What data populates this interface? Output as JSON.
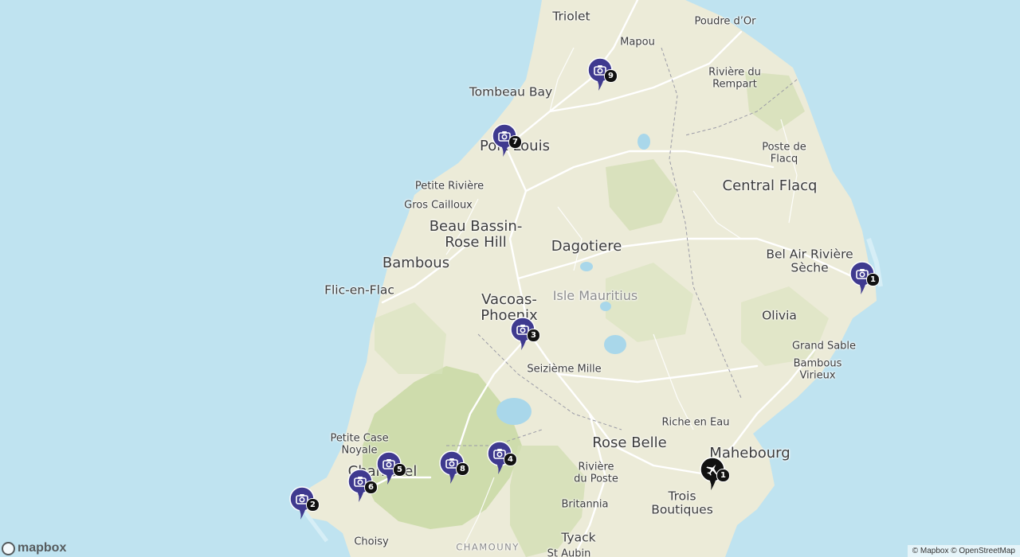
{
  "map": {
    "places": [
      {
        "name": "Triolet",
        "size": "md"
      },
      {
        "name": "Poudre d’Or",
        "size": "sm"
      },
      {
        "name": "Mapou",
        "size": "sm"
      },
      {
        "name": "Rivière du\nRempart",
        "size": "sm"
      },
      {
        "name": "Tombeau Bay",
        "size": "md"
      },
      {
        "name": "Port Louis",
        "size": "lg"
      },
      {
        "name": "Poste de\nFlacq",
        "size": "sm"
      },
      {
        "name": "Central Flacq",
        "size": "lg"
      },
      {
        "name": "Petite Rivière",
        "size": "sm"
      },
      {
        "name": "Gros Cailloux",
        "size": "sm"
      },
      {
        "name": "Beau Bassin-\nRose Hill",
        "size": "lg"
      },
      {
        "name": "Dagotiere",
        "size": "lg"
      },
      {
        "name": "Bambous",
        "size": "lg"
      },
      {
        "name": "Bel Air Rivière\nSèche",
        "size": "md"
      },
      {
        "name": "Flic-en-Flac",
        "size": "md"
      },
      {
        "name": "Vacoas-\nPhoenix",
        "size": "lg"
      },
      {
        "name": "Isle Mauritius",
        "size": "region"
      },
      {
        "name": "Olivia",
        "size": "md"
      },
      {
        "name": "Grand Sable",
        "size": "sm"
      },
      {
        "name": "Seizième Mille",
        "size": "sm"
      },
      {
        "name": "Bambous\nVirieux",
        "size": "sm"
      },
      {
        "name": "Riche en Eau",
        "size": "sm"
      },
      {
        "name": "Petite Case\nNoyale",
        "size": "sm"
      },
      {
        "name": "Rose Belle",
        "size": "lg"
      },
      {
        "name": "Mahebourg",
        "size": "lg"
      },
      {
        "name": "Chamarel",
        "size": "lg"
      },
      {
        "name": "Rivière\ndu Poste",
        "size": "sm"
      },
      {
        "name": "Trois\nBoutiques",
        "size": "md"
      },
      {
        "name": "Britannia",
        "size": "sm"
      },
      {
        "name": "Tyack",
        "size": "md"
      },
      {
        "name": "Choisy",
        "size": "sm"
      },
      {
        "name": "CHAMOUNY",
        "size": "caps"
      },
      {
        "name": "St Aubin",
        "size": "sm"
      }
    ],
    "markers": [
      {
        "id": "1",
        "icon": "camera-icon",
        "color": "#3f3a8f"
      },
      {
        "id": "2",
        "icon": "camera-icon",
        "color": "#3f3a8f"
      },
      {
        "id": "3",
        "icon": "camera-icon",
        "color": "#3f3a8f"
      },
      {
        "id": "4",
        "icon": "camera-icon",
        "color": "#3f3a8f"
      },
      {
        "id": "5",
        "icon": "camera-icon",
        "color": "#3f3a8f"
      },
      {
        "id": "6",
        "icon": "camera-icon",
        "color": "#3f3a8f"
      },
      {
        "id": "7",
        "icon": "camera-icon",
        "color": "#3f3a8f"
      },
      {
        "id": "8",
        "icon": "camera-icon",
        "color": "#3f3a8f"
      },
      {
        "id": "9",
        "icon": "camera-icon",
        "color": "#3f3a8f"
      },
      {
        "id": "1",
        "icon": "airplane-icon",
        "color": "#111111"
      }
    ],
    "logo": "mapbox",
    "attribution": "© Mapbox © OpenStreetMap"
  },
  "colors": {
    "water": "#bfe3f0",
    "land": "#ecebd8",
    "forest": "#cfdcae",
    "road": "#ffffff",
    "lake": "#a9d7ea"
  }
}
